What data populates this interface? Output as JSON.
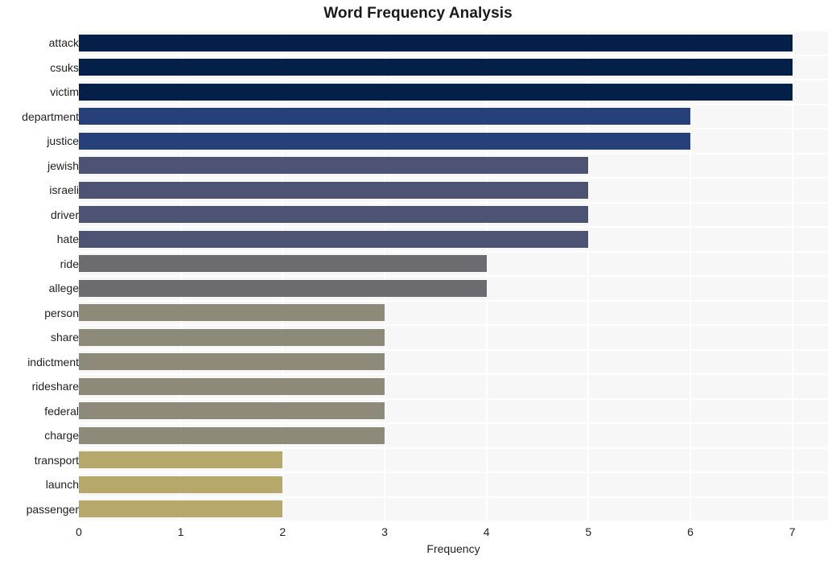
{
  "chart_data": {
    "type": "bar",
    "orientation": "horizontal",
    "title": "Word Frequency Analysis",
    "xlabel": "Frequency",
    "ylabel": "",
    "categories": [
      "attack",
      "csuks",
      "victim",
      "department",
      "justice",
      "jewish",
      "israeli",
      "driver",
      "hate",
      "ride",
      "allege",
      "person",
      "share",
      "indictment",
      "rideshare",
      "federal",
      "charge",
      "transport",
      "launch",
      "passenger"
    ],
    "values": [
      7,
      7,
      7,
      6,
      6,
      5,
      5,
      5,
      5,
      4,
      4,
      3,
      3,
      3,
      3,
      3,
      3,
      2,
      2,
      2
    ],
    "bar_colors": [
      "#042049",
      "#042049",
      "#042049",
      "#26407a",
      "#26407a",
      "#4d5473",
      "#4d5473",
      "#4d5473",
      "#4d5473",
      "#6b6b70",
      "#6b6b70",
      "#8e8a79",
      "#8e8a79",
      "#8e8a79",
      "#8e8a79",
      "#8e8a79",
      "#8e8a79",
      "#b5a86a",
      "#b5a86a",
      "#b5a86a"
    ],
    "xlim": [
      0,
      7.35
    ],
    "xticks": [
      0,
      1,
      2,
      3,
      4,
      5,
      6,
      7
    ],
    "xtick_labels": [
      "0",
      "1",
      "2",
      "3",
      "4",
      "5",
      "6",
      "7"
    ],
    "grid": true,
    "grid_color": "#ffffff",
    "plot_background": "#f7f7f7",
    "figure_background": "#ffffff",
    "legend": null,
    "legend_position": "none"
  }
}
